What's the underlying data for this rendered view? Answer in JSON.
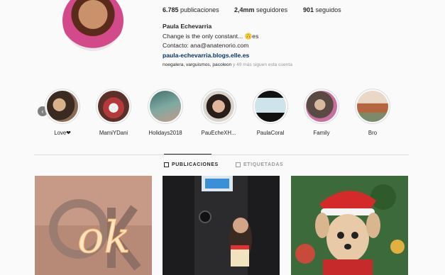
{
  "profile": {
    "name": "Paula Echevarria",
    "bio_line": "Change is the only constant... 🙃es",
    "contact": "Contacto: ana@anatenorio.com",
    "link": "paula-echevarria.blogs.elle.es"
  },
  "stats": {
    "posts_count": "6.785",
    "posts_label": "publicaciones",
    "followers_count": "2,4mm",
    "followers_label": "seguidores",
    "following_count": "901",
    "following_label": "seguidos"
  },
  "followed_by": {
    "names": "noegalera, varguismos, pacoleon",
    "more": " y 49 más siguen esta cuenta"
  },
  "highlights": [
    {
      "label": "Love❤"
    },
    {
      "label": "MamiYDani"
    },
    {
      "label": "Holidays2018"
    },
    {
      "label": "PauEcheXH..."
    },
    {
      "label": "PaulaCoral"
    },
    {
      "label": "Family"
    },
    {
      "label": "Bro"
    }
  ],
  "tabs": [
    {
      "label": "PUBLICACIONES"
    },
    {
      "label": "ETIQUETADAS"
    }
  ],
  "posts": [
    {
      "text": "ok"
    },
    {
      "text": ""
    },
    {
      "text": ""
    }
  ],
  "colors": {
    "link": "#003569",
    "border": "#dbdbdb",
    "muted": "#999999"
  }
}
